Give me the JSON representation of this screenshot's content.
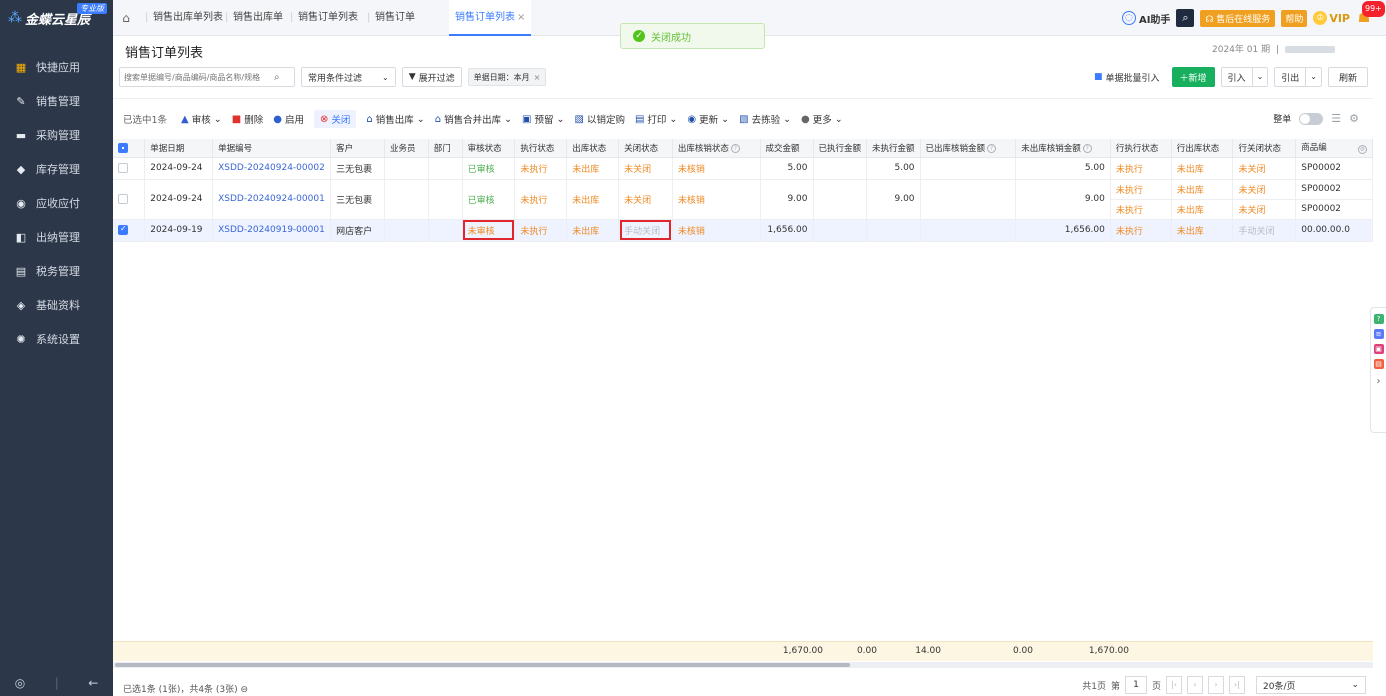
{
  "brand": {
    "name": "金蝶云星辰",
    "edition": "专业版"
  },
  "sidebar": {
    "items": [
      {
        "label": "快捷应用"
      },
      {
        "label": "销售管理"
      },
      {
        "label": "采购管理"
      },
      {
        "label": "库存管理"
      },
      {
        "label": "应收应付"
      },
      {
        "label": "出纳管理"
      },
      {
        "label": "税务管理"
      },
      {
        "label": "基础资料"
      },
      {
        "label": "系统设置"
      }
    ]
  },
  "tabs": [
    {
      "label": "销售出库单列表"
    },
    {
      "label": "销售出库单"
    },
    {
      "label": "销售订单列表"
    },
    {
      "label": "销售订单"
    },
    {
      "label": "销售订单列表"
    }
  ],
  "toast": {
    "text": "关闭成功"
  },
  "topbar": {
    "ai": "AI助手",
    "service": "售后在线服务",
    "help": "帮助",
    "vip": "VIP",
    "notif_count": "99+"
  },
  "page": {
    "title": "销售订单列表",
    "period": "2024年 01 期"
  },
  "filters": {
    "search_placeholder": "搜索单据编号/商品编码/商品名称/规格",
    "preset": "常用条件过滤",
    "expand": "展开过滤",
    "date_tag": "单据日期：本月"
  },
  "actions": {
    "bulk_import": "单据批量引入",
    "new": "新增",
    "import": "引入",
    "export": "引出",
    "refresh": "刷新"
  },
  "toolbar": {
    "selected": "已选中1条",
    "audit": "审核",
    "delete": "删除",
    "enable": "启用",
    "close": "关闭",
    "outbound": "销售出库",
    "merge_outbound": "销售合并出库",
    "reserve": "预留",
    "purchase": "以销定购",
    "print": "打印",
    "update": "更新",
    "pick": "去拣验",
    "more": "更多",
    "whole": "整单"
  },
  "table": {
    "headers": [
      "单据日期",
      "单据编号",
      "客户",
      "业务员",
      "部门",
      "审核状态",
      "执行状态",
      "出库状态",
      "关闭状态",
      "出库核销状态",
      "成交金额",
      "已执行金额",
      "未执行金额",
      "已出库核销金额",
      "未出库核销金额",
      "行执行状态",
      "行出库状态",
      "行关闭状态",
      "商品编"
    ],
    "rows": [
      {
        "date": "2024-09-24",
        "no": "XSDD-20240924-00002",
        "customer": "三无包裹",
        "audit": "已审核",
        "exec": "未执行",
        "out": "未出库",
        "close": "未关闭",
        "verify": "未核销",
        "amount": "5.00",
        "unexec": "5.00",
        "unverify": "5.00",
        "lines": [
          {
            "exec": "未执行",
            "out": "未出库",
            "close": "未关闭",
            "code": "SP00002"
          }
        ]
      },
      {
        "date": "2024-09-24",
        "no": "XSDD-20240924-00001",
        "customer": "三无包裹",
        "audit": "已审核",
        "exec": "未执行",
        "out": "未出库",
        "close": "未关闭",
        "verify": "未核销",
        "amount": "9.00",
        "unexec": "9.00",
        "unverify": "9.00",
        "lines": [
          {
            "exec": "未执行",
            "out": "未出库",
            "close": "未关闭",
            "code": "SP00002"
          },
          {
            "exec": "未执行",
            "out": "未出库",
            "close": "未关闭",
            "code": "SP00002"
          }
        ]
      },
      {
        "date": "2024-09-19",
        "no": "XSDD-20240919-00001",
        "customer": "网店客户",
        "audit": "未审核",
        "exec": "未执行",
        "out": "未出库",
        "close": "手动关闭",
        "verify": "未核销",
        "amount": "1,656.00",
        "unexec": "",
        "unverify": "1,656.00",
        "lines": [
          {
            "exec": "未执行",
            "out": "未出库",
            "close": "手动关闭",
            "code": "00.00.00.0"
          }
        ]
      }
    ]
  },
  "totals": {
    "amount": "1,670.00",
    "executed": "0.00",
    "unexecuted": "14.00",
    "verified": "0.00",
    "unverified": "1,670.00"
  },
  "footer": {
    "info": "已选1条 (1张)，共4条 (3张)",
    "pages": "共1页",
    "page_prefix": "第",
    "page_no": "1",
    "page_suffix": "页",
    "page_size": "20条/页"
  },
  "colors": {
    "accent": "#3a7bff",
    "sidebar": "#2c3749",
    "success": "#18b05e",
    "warning": "#f08a24"
  }
}
